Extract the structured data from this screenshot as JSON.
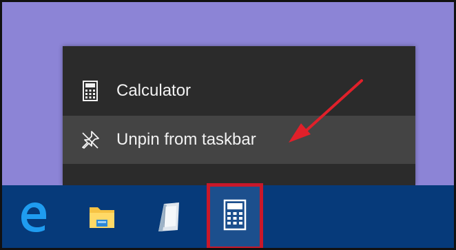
{
  "context_menu": {
    "items": [
      {
        "label": "Calculator",
        "icon": "calculator-icon"
      },
      {
        "label": "Unpin from taskbar",
        "icon": "unpin-icon"
      }
    ]
  },
  "taskbar": {
    "apps": [
      {
        "icon": "edge-icon"
      },
      {
        "icon": "file-explorer-icon"
      },
      {
        "icon": "notepad-icon"
      },
      {
        "icon": "calculator-icon",
        "highlighted": true
      }
    ]
  },
  "annotation": {
    "arrow_color": "#e0202a",
    "highlight_color": "#c8182a"
  },
  "colors": {
    "desktop": "#8c84d6",
    "menu_bg": "#2b2b2b",
    "menu_hover": "#444444",
    "taskbar": "#063a7a"
  }
}
